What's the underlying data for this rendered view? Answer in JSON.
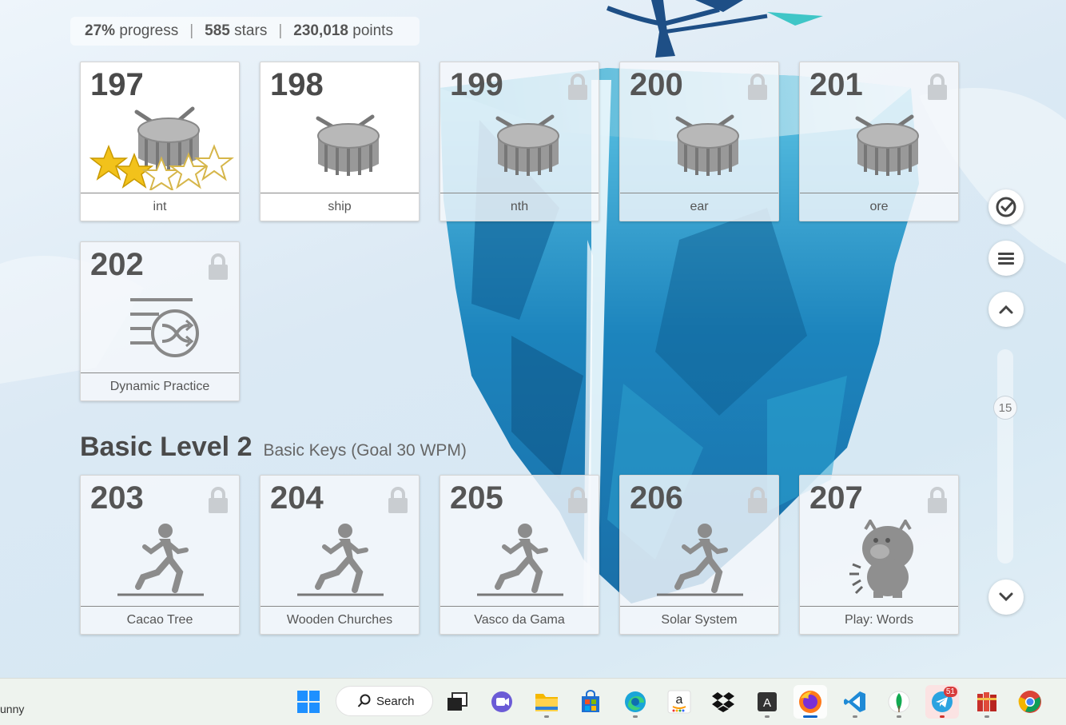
{
  "stats": {
    "progress_value": "27%",
    "progress_label": "progress",
    "stars_value": "585",
    "stars_label": "stars",
    "points_value": "230,018",
    "points_label": "points"
  },
  "lessons_top": [
    {
      "number": "197",
      "label": "int",
      "locked": false,
      "icon": "drum-icon",
      "stars": 2,
      "max_stars": 5
    },
    {
      "number": "198",
      "label": "ship",
      "locked": false,
      "icon": "drum-icon"
    },
    {
      "number": "199",
      "label": "nth",
      "locked": true,
      "icon": "drum-icon"
    },
    {
      "number": "200",
      "label": "ear",
      "locked": true,
      "icon": "drum-icon"
    },
    {
      "number": "201",
      "label": "ore",
      "locked": true,
      "icon": "drum-icon"
    },
    {
      "number": "202",
      "label": "Dynamic Practice",
      "locked": true,
      "icon": "shuffle-list-icon"
    }
  ],
  "section": {
    "title": "Basic Level 2",
    "subtitle": "Basic Keys (Goal 30 WPM)"
  },
  "lessons_bottom": [
    {
      "number": "203",
      "label": "Cacao Tree",
      "locked": true,
      "icon": "runner-icon"
    },
    {
      "number": "204",
      "label": "Wooden Churches",
      "locked": true,
      "icon": "runner-icon"
    },
    {
      "number": "205",
      "label": "Vasco da Gama",
      "locked": true,
      "icon": "runner-icon"
    },
    {
      "number": "206",
      "label": "Solar System",
      "locked": true,
      "icon": "runner-icon"
    },
    {
      "number": "207",
      "label": "Play: Words",
      "locked": true,
      "icon": "monster-icon"
    }
  ],
  "sidebar": {
    "scroll_value": "15",
    "buttons": [
      "check-circle-icon",
      "menu-icon",
      "chevron-up-icon",
      "chevron-down-icon"
    ]
  },
  "taskbar": {
    "corner_text": "unny",
    "search_label": "Search",
    "telegram_badge": "51",
    "apps": [
      "windows-start-icon",
      "task-view-icon",
      "meet-icon",
      "file-explorer-icon",
      "store-icon",
      "edge-icon",
      "amazon-icon",
      "dropbox-icon",
      "font-app-icon",
      "firefox-icon",
      "vscode-icon",
      "mongodb-icon",
      "telegram-icon",
      "books-icon",
      "chrome-icon"
    ]
  },
  "colors": {
    "card_text": "#4a4a4a",
    "water_blue": "#1a7fb8",
    "star_gold": "#f2c21b",
    "active_indicator": "#0a64c8"
  }
}
